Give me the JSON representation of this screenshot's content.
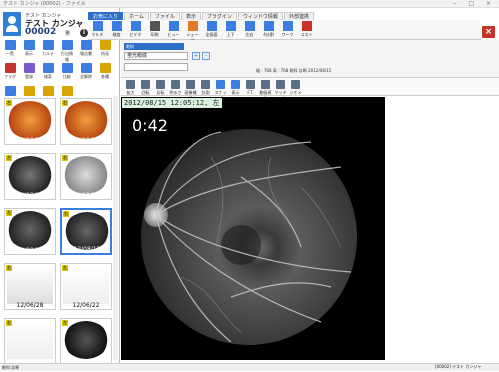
{
  "window": {
    "title": "テスト カンジャ (00002) - ファイル",
    "controls": "–  □  ×"
  },
  "patient": {
    "kana": "テスト  カンジャ",
    "name": "テスト カンジャ",
    "id": "00002",
    "gender": "男",
    "info_icon": "info-icon"
  },
  "tabs": [
    "お気に入り",
    "ホーム",
    "ファイル",
    "表示",
    "プラグイン",
    "ウィンドウ情報",
    "外部連携"
  ],
  "active_tab": "お気に入り",
  "ribbon": [
    "マルチ",
    "検査",
    "ビデオ",
    "印刷",
    "ビューア",
    "シェーマ",
    "全画面",
    "上下",
    "左右",
    "4分割",
    "ワーク",
    "コスト"
  ],
  "left_tools": [
    "一覧",
    "表示",
    "カルテ",
    "打出情報",
    "報告書",
    "所見",
    "フラグ",
    "登録",
    "検索",
    "比較",
    "全解除",
    "各種",
    "クイック",
    "左",
    "右",
    "左/右"
  ],
  "control": {
    "label": "眼科",
    "exam_value": "蛍光眼底",
    "plus": "+",
    "minus": "-",
    "status": "幅 : 768 高 : 768  眼科  診断  2012/08/15"
  },
  "image_tools": [
    "拡大",
    "回転",
    "反転",
    "明るさ",
    "画像補正",
    "計測",
    "スナップ",
    "表示",
    "F.T.",
    "動画再生",
    "マッチング",
    "ジオメトリ"
  ],
  "viewer": {
    "timestamp": "2012/08/15 12:05:12, 左",
    "timer": "0:42"
  },
  "thumbnails": [
    {
      "date": "12/08/15",
      "tag": "左"
    },
    {
      "date": "12/08/15",
      "tag": "右"
    },
    {
      "date": "12/08/15",
      "tag": "左"
    },
    {
      "date": "12/08/15",
      "tag": "右"
    },
    {
      "date": "12/08/15",
      "tag": "左"
    },
    {
      "date": "12/08/15",
      "tag": "右"
    },
    {
      "date": "12/06/28",
      "tag": "右"
    },
    {
      "date": "12/06/22",
      "tag": "左"
    },
    {
      "date": "",
      "tag": "右"
    },
    {
      "date": "",
      "tag": "左"
    }
  ],
  "statusbar": {
    "left": "眼科  診断",
    "right": "[00002] テスト  カンジャ"
  }
}
